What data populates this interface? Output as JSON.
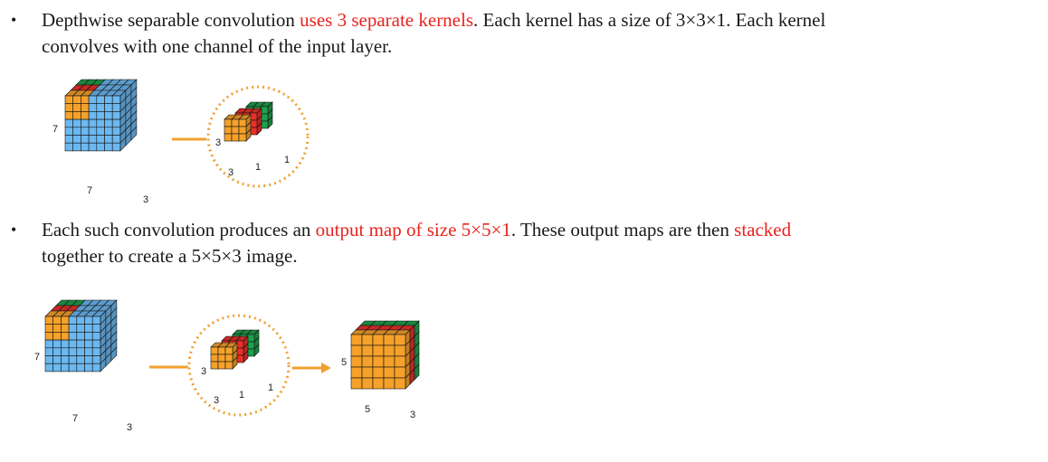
{
  "bullet1": {
    "marker": "•",
    "text_a": "Depthwise separable convolution ",
    "highlight": "uses 3 separate kernels",
    "text_b": ". Each kernel has a size of 3",
    "times": "×",
    "three": "3",
    "text_c": "1. Each kernel",
    "line2": "convolves with one channel of the input layer."
  },
  "bullet2": {
    "marker": "•",
    "text_a": " Each such convolution produces an ",
    "highlight1": "output map of size 5",
    "times": "×",
    "five": "5",
    "one": "1",
    "text_b": ". These output maps are then ",
    "highlight2": "stacked",
    "line2_a": "together to create a 5",
    "line2_b": "5",
    "line2_c": "3 image."
  },
  "diagram1": {
    "input_height_label": "7",
    "input_width_label": "7",
    "input_depth_label": "3",
    "kernel_height_label": "3",
    "kernel_width_label": "3",
    "kernel_depth_label_1": "1",
    "kernel_depth_label_2": "1"
  },
  "diagram2": {
    "input_height_label": "7",
    "input_width_label": "7",
    "input_depth_label": "3",
    "kernel_height_label": "3",
    "kernel_width_label": "3",
    "kernel_depth_label_1": "1",
    "kernel_depth_label_2": "1",
    "output_height_label": "5",
    "output_width_label": "5",
    "output_depth_label": "3"
  },
  "colors": {
    "highlight": "#e8231e",
    "blue": "#6cb8f0",
    "orange": "#f5a12a",
    "red": "#e8302c",
    "green": "#1fa04a",
    "connector": "#f0a030"
  }
}
